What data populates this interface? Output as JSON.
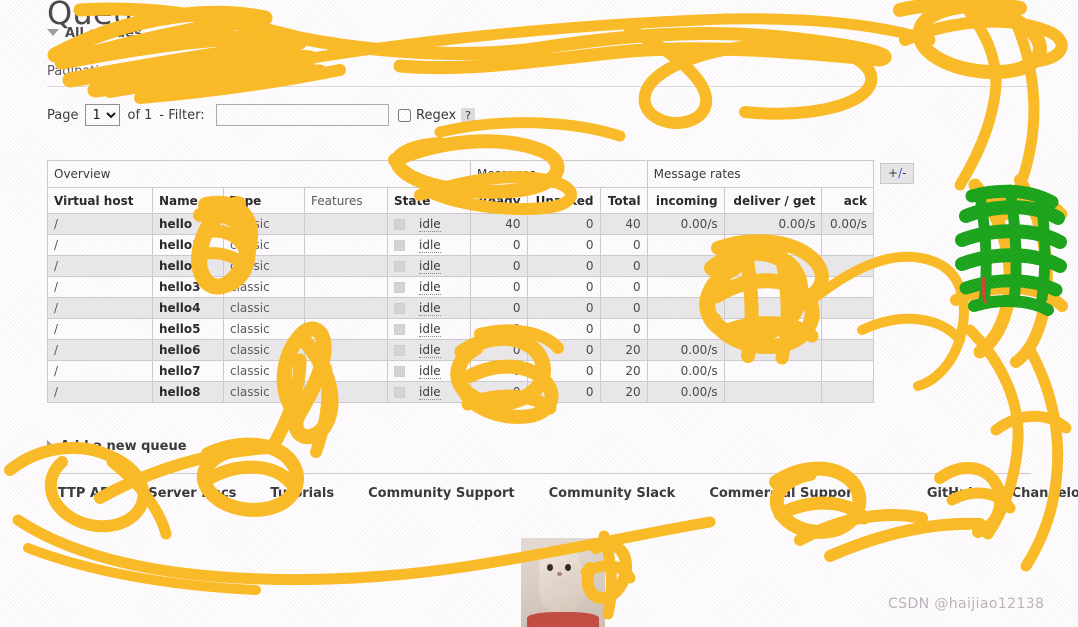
{
  "page": {
    "title": "Queues",
    "section_expander": "All queues",
    "subheading": "Pagination"
  },
  "pagination": {
    "page_label": "Page",
    "page_value": "1",
    "page_options": [
      "1"
    ],
    "of_label": "of 1",
    "filter_label": "- Filter:",
    "filter_value": "",
    "filter_placeholder": "",
    "regex_label": "Regex",
    "regex_checked": false,
    "help_glyph": "?"
  },
  "table": {
    "group_headers": [
      {
        "label": "Overview",
        "span": 5
      },
      {
        "label": "Messages",
        "span": 3
      },
      {
        "label": "Message rates",
        "span": 3
      }
    ],
    "columns": [
      {
        "label": "Virtual host",
        "align": "left",
        "bold": true
      },
      {
        "label": "Name",
        "align": "left",
        "bold": true
      },
      {
        "label": "Type",
        "align": "left",
        "bold": true
      },
      {
        "label": "Features",
        "align": "left",
        "bold": false
      },
      {
        "label": "State",
        "align": "left",
        "bold": true
      },
      {
        "label": "Ready",
        "align": "right",
        "bold": true
      },
      {
        "label": "Unacked",
        "align": "right",
        "bold": true
      },
      {
        "label": "Total",
        "align": "right",
        "bold": true
      },
      {
        "label": "incoming",
        "align": "right",
        "bold": true
      },
      {
        "label": "deliver / get",
        "align": "right",
        "bold": true
      },
      {
        "label": "ack",
        "align": "right",
        "bold": true
      }
    ],
    "toggle_columns_label": "+/-",
    "rows": [
      {
        "vhost": "/",
        "name": "hello",
        "type": "classic",
        "features": "",
        "state": "idle",
        "ready": "40",
        "unacked": "0",
        "total": "40",
        "incoming": "0.00/s",
        "deliver_get": "0.00/s",
        "ack": "0.00/s"
      },
      {
        "vhost": "/",
        "name": "hello1",
        "type": "classic",
        "features": "",
        "state": "idle",
        "ready": "0",
        "unacked": "0",
        "total": "0",
        "incoming": "",
        "deliver_get": "",
        "ack": ""
      },
      {
        "vhost": "/",
        "name": "hello2",
        "type": "classic",
        "features": "",
        "state": "idle",
        "ready": "0",
        "unacked": "0",
        "total": "0",
        "incoming": "",
        "deliver_get": "",
        "ack": ""
      },
      {
        "vhost": "/",
        "name": "hello3",
        "type": "classic",
        "features": "",
        "state": "idle",
        "ready": "0",
        "unacked": "0",
        "total": "0",
        "incoming": "",
        "deliver_get": "",
        "ack": ""
      },
      {
        "vhost": "/",
        "name": "hello4",
        "type": "classic",
        "features": "",
        "state": "idle",
        "ready": "0",
        "unacked": "0",
        "total": "0",
        "incoming": "",
        "deliver_get": "",
        "ack": ""
      },
      {
        "vhost": "/",
        "name": "hello5",
        "type": "classic",
        "features": "",
        "state": "idle",
        "ready": "0",
        "unacked": "0",
        "total": "0",
        "incoming": "",
        "deliver_get": "",
        "ack": ""
      },
      {
        "vhost": "/",
        "name": "hello6",
        "type": "classic",
        "features": "",
        "state": "idle",
        "ready": "0",
        "unacked": "0",
        "total": "20",
        "incoming": "0.00/s",
        "deliver_get": "",
        "ack": ""
      },
      {
        "vhost": "/",
        "name": "hello7",
        "type": "classic",
        "features": "",
        "state": "idle",
        "ready": "0",
        "unacked": "0",
        "total": "20",
        "incoming": "0.00/s",
        "deliver_get": "",
        "ack": ""
      },
      {
        "vhost": "/",
        "name": "hello8",
        "type": "classic",
        "features": "",
        "state": "idle",
        "ready": "0",
        "unacked": "0",
        "total": "20",
        "incoming": "0.00/s",
        "deliver_get": "",
        "ack": ""
      }
    ]
  },
  "add_queue": {
    "label": "Add a new queue"
  },
  "footer": {
    "links": [
      "HTTP API",
      "Server Docs",
      "Tutorials",
      "Community Support",
      "Community Slack",
      "Commercial Support",
      "GitHub",
      "Changelog"
    ]
  },
  "watermark": {
    "text": "CSDN @haijiao12138"
  },
  "colors": {
    "scribble_orange": "#FCBB1E",
    "scribble_green": "#13A313",
    "row_stripe": "#eaeaea",
    "accent_blue": "#2a4fd6"
  }
}
